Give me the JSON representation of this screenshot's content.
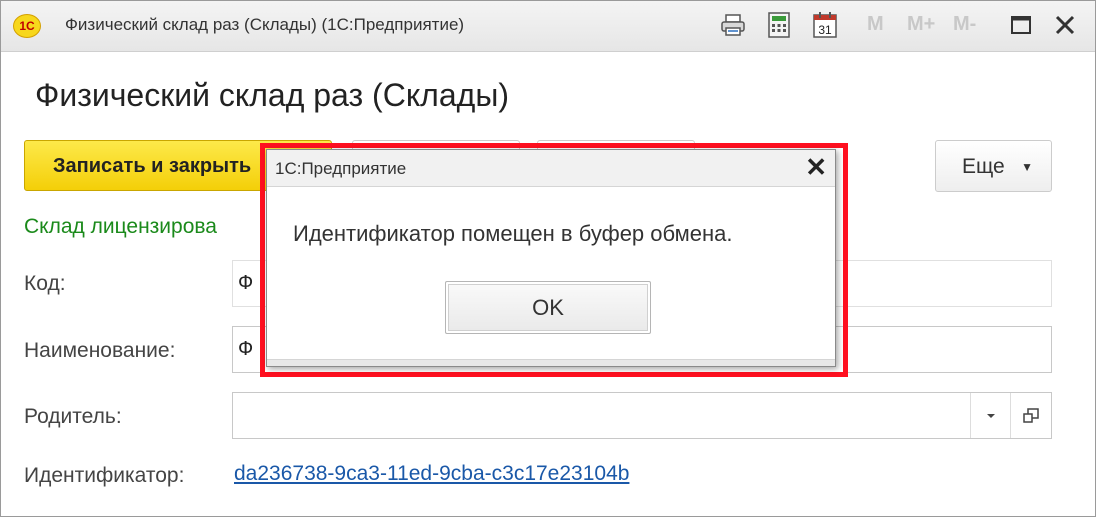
{
  "window": {
    "title": "Физический склад раз (Склады)  (1С:Предприятие)",
    "logo_text": "1С",
    "toolbar_icons": [
      "print-icon",
      "calculator-icon",
      "calendar-icon"
    ],
    "calendar_day": "31",
    "memory_buttons": [
      "M",
      "M+",
      "M-"
    ]
  },
  "form": {
    "title": "Физический склад раз (Склады)",
    "save_close_label": "Записать и закрыть",
    "more_label": "Еще",
    "license_text": "Склад лицензирова",
    "code_label": "Код:",
    "code_value": "Ф",
    "name_label": "Наименование:",
    "name_value": "Ф",
    "parent_label": "Родитель:",
    "parent_value": "",
    "id_label": "Идентификатор:",
    "id_value": "da236738-9ca3-11ed-9cba-c3c17e23104b"
  },
  "dialog": {
    "title": "1С:Предприятие",
    "message": "Идентификатор помещен в буфер обмена.",
    "ok_label": "OK"
  },
  "colors": {
    "accent_yellow": "#f4cf08",
    "highlight_red": "#ff1020",
    "link_blue": "#1a58a8",
    "status_green": "#1b8a1b"
  }
}
